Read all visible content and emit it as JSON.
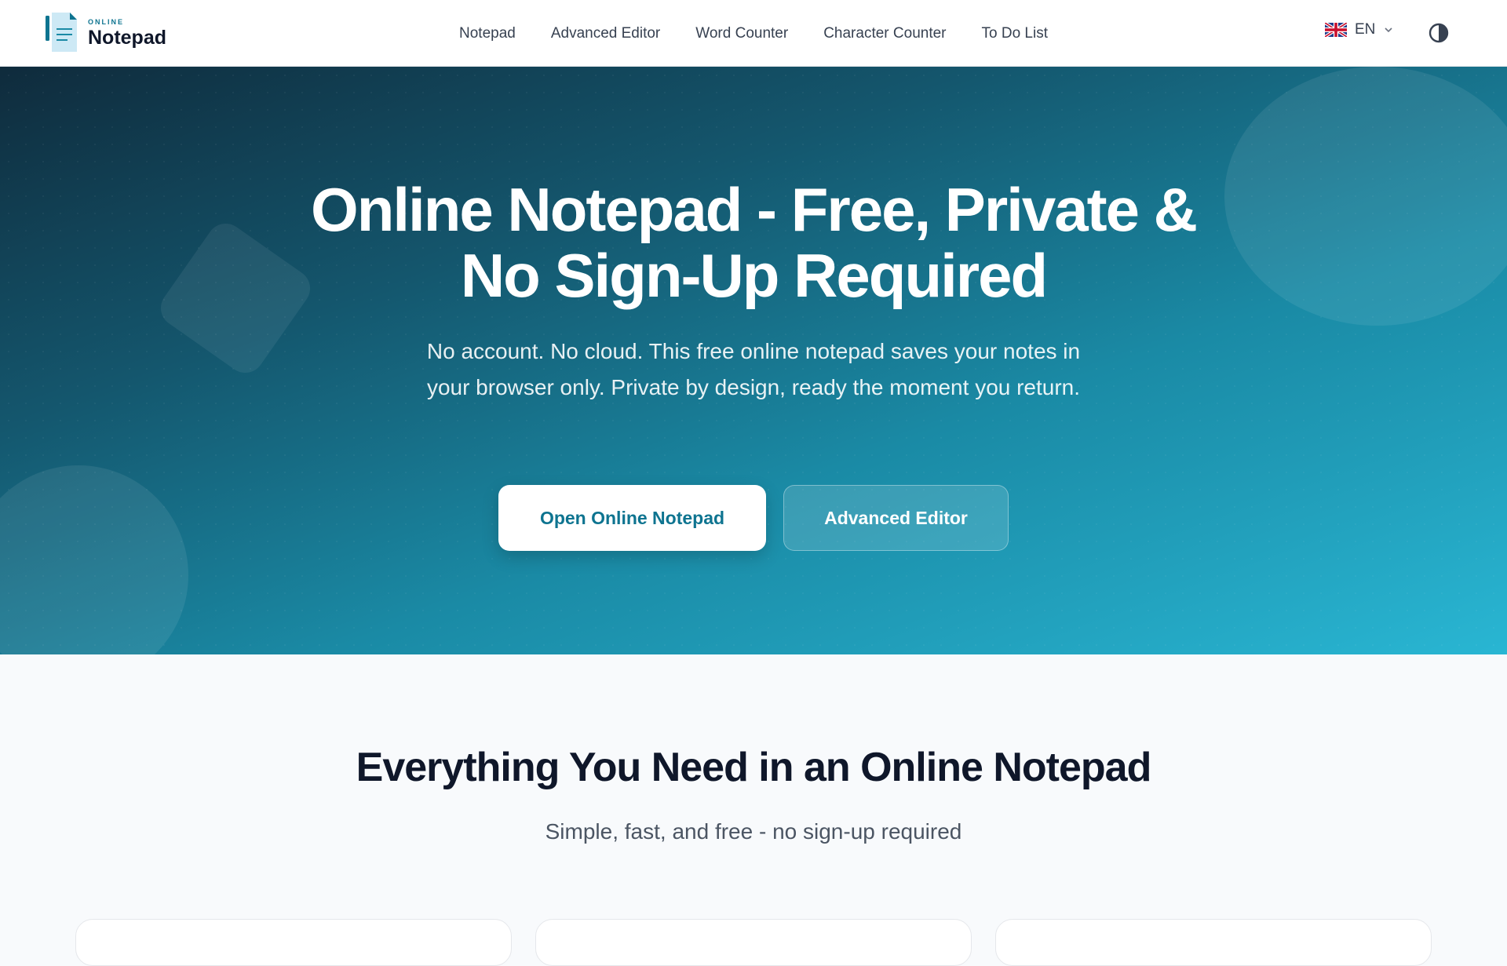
{
  "brand": {
    "small": "ONLINE",
    "name": "Notepad"
  },
  "nav": {
    "items": [
      {
        "label": "Notepad"
      },
      {
        "label": "Advanced Editor"
      },
      {
        "label": "Word Counter"
      },
      {
        "label": "Character Counter"
      },
      {
        "label": "To Do List"
      }
    ]
  },
  "language": {
    "code": "EN",
    "flag_icon": "uk-flag-icon"
  },
  "theme_toggle": {
    "icon": "contrast-icon"
  },
  "hero": {
    "title": "Online Notepad - Free, Private & No Sign-Up Required",
    "subtitle": "No account. No cloud. This free online notepad saves your notes in your browser only. Private by design, ready the moment you return.",
    "primary_button": "Open Online Notepad",
    "secondary_button": "Advanced Editor"
  },
  "features": {
    "title": "Everything You Need in an Online Notepad",
    "subtitle": "Simple, fast, and free - no sign-up required"
  },
  "colors": {
    "accent": "#0e7490",
    "hero_start": "#0f2b3c",
    "hero_end": "#29b6d3"
  }
}
